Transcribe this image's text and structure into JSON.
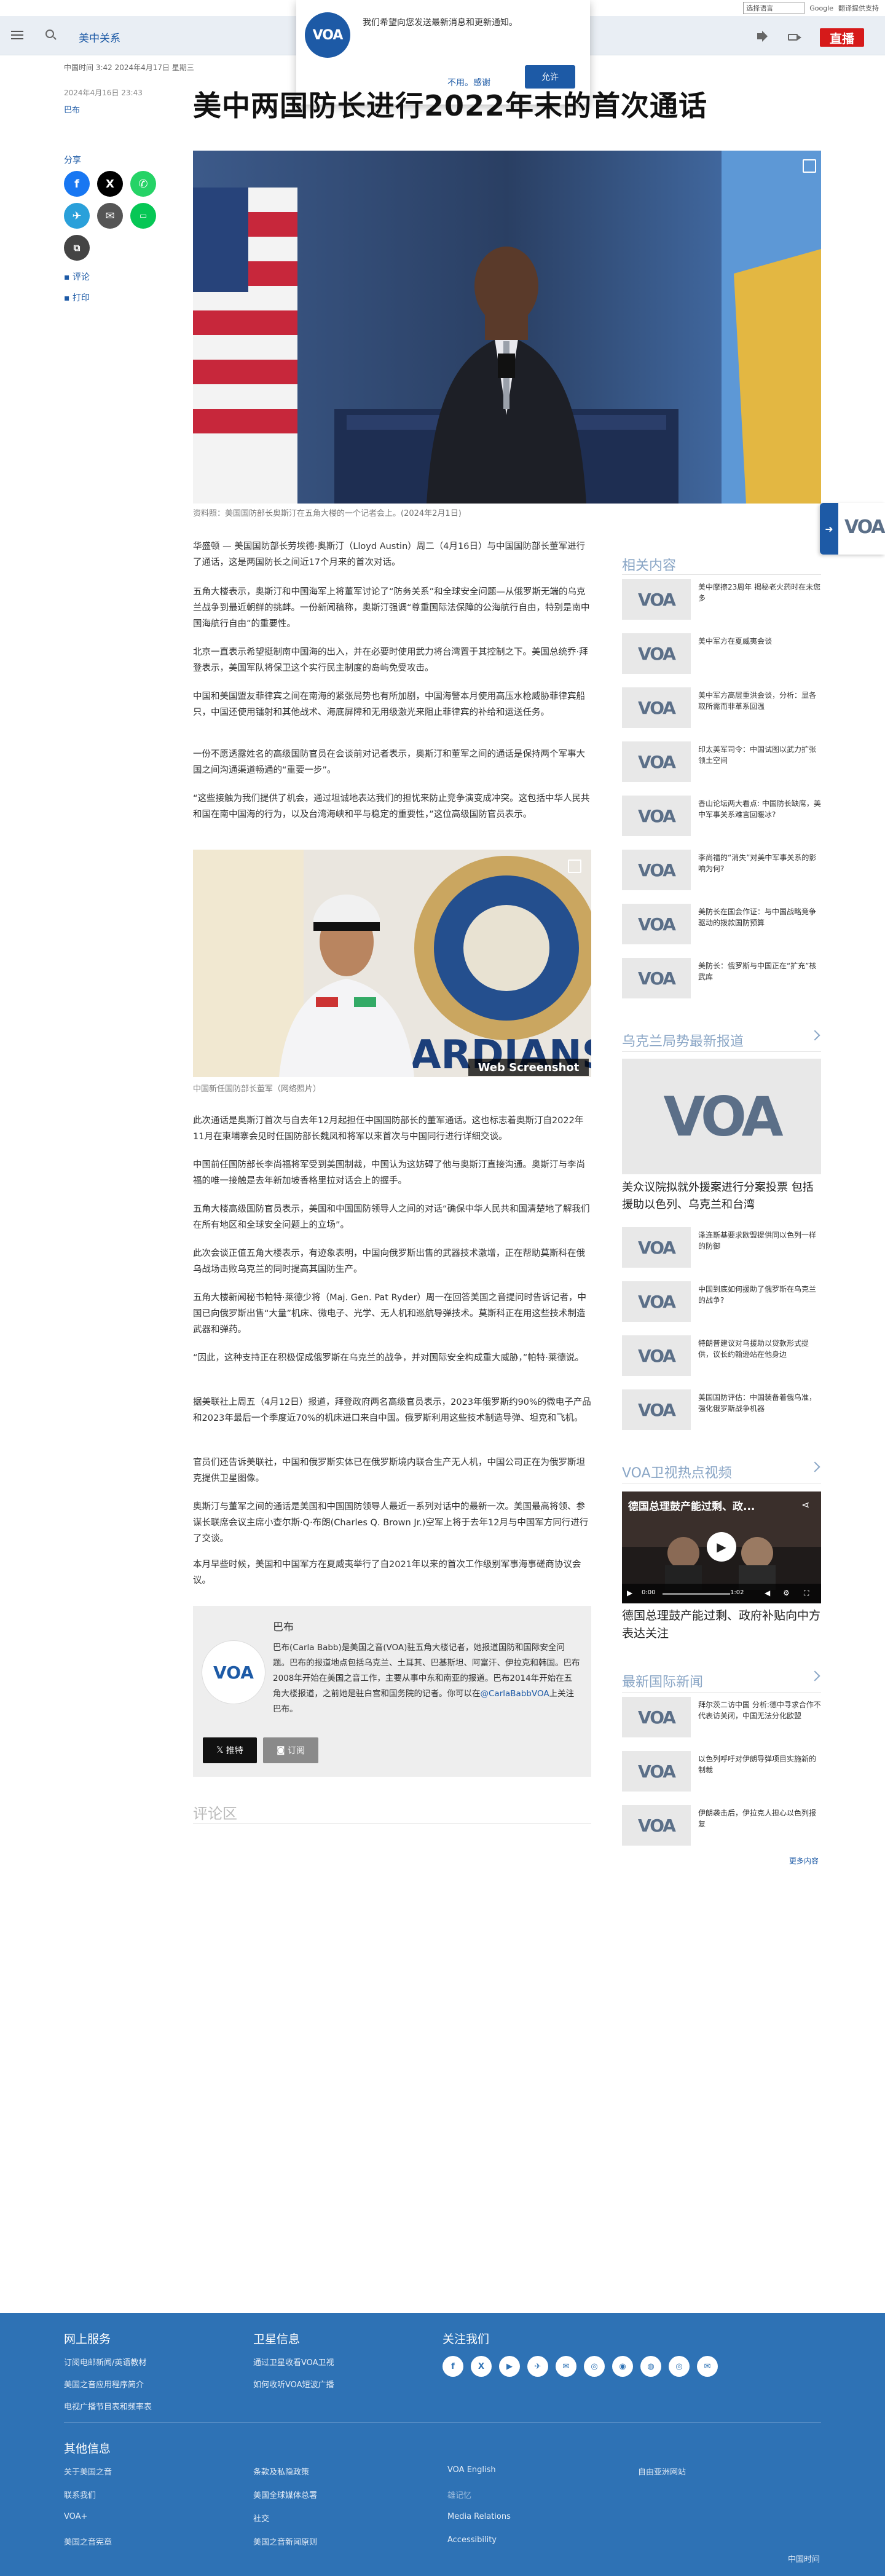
{
  "translate": {
    "select": "选择语言",
    "google": "Google",
    "powered": "翻译提供支持"
  },
  "header": {
    "section": "美中关系",
    "live": "直播"
  },
  "notification": {
    "logo": "VOA",
    "text": "我们希望向您发送最新消息和更新通知。",
    "decline": "不用。感谢",
    "accept": "允许"
  },
  "meta": {
    "date": "中国时间 3:42 2024年4月17日 星期三",
    "published": "2024年4月16日 23:43",
    "author": "巴布"
  },
  "headline": "美中两国防长进行2022年末的首次通话",
  "share": {
    "label": "分享",
    "comment": "评论",
    "print": "打印"
  },
  "hero": {
    "caption": "资料照：美国国防部长奥斯汀在五角大楼的一个记者会上。(2024年2月1日)"
  },
  "paragraphs": [
    "华盛顿 — 美国国防部长劳埃德·奥斯汀（Lloyd Austin）周二（4月16日）与中国国防部长董军进行了通话，这是两国防长之间近17个月来的首次对话。",
    "五角大楼表示，奥斯汀和中国海军上将董军讨论了“防务关系”和全球安全问题—从俄罗斯无端的乌克兰战争到最近朝鲜的挑衅。一份新闻稿称，奥斯汀强调“尊重国际法保障的公海航行自由，特别是南中国海航行自由”的重要性。",
    "北京一直表示希望挺制南中国海的出入，并在必要时使用武力将台湾置于其控制之下。美国总统乔·拜登表示，美国军队将保卫这个实行民主制度的岛屿免受攻击。",
    "中国和美国盟友菲律宾之间在南海的紧张局势也有所加剧，中国海警本月使用高压水枪威胁菲律宾船只，中国还使用镭射和其他战术、海底屏障和无用级激光来阻止菲律宾的补给和运送任务。",
    "一份不愿透露姓名的高级国防官员在会谈前对记者表示，奥斯汀和董军之间的通话是保持两个军事大国之间沟通渠道畅通的“重要一步”。",
    "“这些接触为我们提供了机会，通过坦诚地表达我们的担忧来防止竞争演变成冲突。这包括中华人民共和国在南中国海的行为，以及台湾海峡和平与稳定的重要性，”这位高级国防官员表示。"
  ],
  "photo2": {
    "caption": "中国新任国防部长董军（网络照片）",
    "watermark": "Web Screenshot"
  },
  "paragraphs2": [
    "此次通话是奥斯汀首次与自去年12月起担任中国国防部长的董军通话。这也标志着奥斯汀自2022年11月在柬埔寨会见时任国防部长魏凤和将军以来首次与中国同行进行详细交谈。",
    "中国前任国防部长李尚福将军受到美国制裁，中国认为这妨碍了他与奥斯汀直接沟通。奥斯汀与李尚福的唯一接触是去年新加坡香格里拉对话会上的握手。",
    "五角大楼高级国防官员表示，美国和中国国防领导人之间的对话“确保中华人民共和国清楚地了解我们在所有地区和全球安全问题上的立场”。",
    "此次会谈正值五角大楼表示，有迹象表明，中国向俄罗斯出售的武器技术激增，正在帮助莫斯科在俄乌战场击败乌克兰的同时提高其国防生产。",
    "五角大楼新闻秘书帕特·莱德少将（Maj. Gen. Pat Ryder）周一在回答美国之音提问时告诉记者，中国已向俄罗斯出售“大量”机床、微电子、光学、无人机和巡航导弹技术。莫斯科正在用这些技术制造武器和弹药。",
    "“因此，这种支持正在积极促成俄罗斯在乌克兰的战争，并对国际安全构成重大威胁，”帕特·莱德说。",
    "据美联社上周五（4月12日）报道，拜登政府两名高级官员表示，2023年俄罗斯约90%的微电子产品和2023年最后一个季度近70%的机床进口来自中国。俄罗斯利用这些技术制造导弹、坦克和飞机。",
    "官员们还告诉美联社，中国和俄罗斯实体已在俄罗斯境内联合生产无人机，中国公司正在为俄罗斯坦克提供卫星图像。",
    "奥斯汀与董军之间的通话是美国和中国国防领导人最近一系列对话中的最新一次。美国最高将领、参谋长联席会议主席小查尔斯·Q·布朗(Charles Q. Brown Jr.)空军上将于去年12月与中国军方同行进行了交谈。",
    "本月早些时候，美国和中国军方在夏威夷举行了自2021年以来的首次工作级别军事海事磋商协议会议。"
  ],
  "author_box": {
    "name": "巴布",
    "avatar": "VOA",
    "bio": "巴布(Carla Babb)是美国之音(VOA)驻五角大楼记者，她报道国防和国际安全问题。巴布的报道地点包括乌克兰、土耳其、巴基斯坦、阿富汗、伊拉克和韩国。巴布2008年开始在美国之音工作，主要从事中东和南亚的报道。巴布2014年开始在五角大楼报道，之前她是驻白宫和国务院的记者。你可以在",
    "twitter": "@CarlaBabbVOA",
    "bio_end": "上关注巴布。",
    "follow_x": "推特",
    "follow_rss": "订阅"
  },
  "comments": {
    "title": "评论区"
  },
  "sidebar": {
    "related_title": "相关内容",
    "related": [
      {
        "thumb": "VOA",
        "title": "美中摩擦23周年 揭秘老火药时在未您多"
      },
      {
        "thumb": "VOA",
        "title": "美中军方在夏威夷会谈"
      },
      {
        "thumb": "VOA",
        "title": "美中军方高层重洪会谈，分析：显各取所需而非革系回温"
      },
      {
        "thumb": "VOA",
        "title": "印太美军司令：中国试图以武力扩张领土空间"
      },
      {
        "thumb": "VOA",
        "title": "香山论坛两大看点: 中国防长缺席，美中军事关系难言回暖冰?"
      },
      {
        "thumb": "VOA",
        "title": "李尚福的“消失”对美中军事关系的影响为何?"
      },
      {
        "thumb": "VOA",
        "title": "美防长在国会作证：与中国战略竞争驱动的拨款国防预算"
      },
      {
        "thumb": "VOA",
        "title": "美防长：俄罗斯与中国正在“扩充”核武库"
      }
    ],
    "ukraine_title": "乌克兰局势最新报道",
    "ukraine_hero": "VOA",
    "ukraine_hero_title": "美众议院拟就外援案进行分案投票 包括援助以色列、乌克兰和台湾",
    "ukraine": [
      {
        "thumb": "VOA",
        "title": "泽连斯基要求欧盟提供同以色列一样的防御"
      },
      {
        "thumb": "VOA",
        "title": "中国到底如何援助了俄罗斯在乌克兰的战争?"
      },
      {
        "thumb": "VOA",
        "title": "特朗普建议对乌援助以贷款形式提供，议长约翰逊站在他身边"
      },
      {
        "thumb": "VOA",
        "title": "美国国防评估：中国装备着俄乌准，强化俄罗斯战争机器"
      }
    ],
    "tv_title": "VOA卫视热点视频",
    "video": {
      "overlay": "德国总理鼓产能过剩、政...",
      "time": "0:00",
      "duration": "1:02"
    },
    "video_title": "德国总理鼓产能过剩、政府补贴向中方表达关注",
    "intl_title": "最新国际新闻",
    "intl": [
      {
        "thumb": "VOA",
        "title": "拜尔茨二访中国 分析:德中寻求合作不代表访关闭，中国无法分化欧盟"
      },
      {
        "thumb": "VOA",
        "title": "以色列呼吁对伊朗导弹项目实施新的制裁"
      },
      {
        "thumb": "VOA",
        "title": "伊朗袭击后，伊拉克人担心以色列报复"
      }
    ],
    "more": "更多内容"
  },
  "footer": {
    "online_title": "网上服务",
    "online": [
      "订阅电邮新闻/英语教材",
      "美国之音应用程序简介",
      "电视广播节目表和频率表"
    ],
    "satellite_title": "卫星信息",
    "satellite": [
      "通过卫星收看VOA卫视",
      "如何收听VOA短波广播"
    ],
    "follow_title": "关注我们",
    "social": [
      "f",
      "X",
      "▶",
      "✈",
      "✉",
      "◎",
      "◉",
      "◍",
      "◎",
      "✉"
    ],
    "other_title": "其他信息",
    "other": [
      [
        "关于美国之音",
        "条款及私隐政策",
        "VOA English",
        "自由亚洲网站"
      ],
      [
        "联系我们",
        "美国全球媒体总署",
        "雄记忆",
        ""
      ],
      [
        "VOA+",
        "社交",
        "Media Relations",
        ""
      ],
      [
        "美国之音宪章",
        "美国之音新闻原则",
        "Accessibility",
        ""
      ]
    ],
    "copyright": "中国时间"
  }
}
